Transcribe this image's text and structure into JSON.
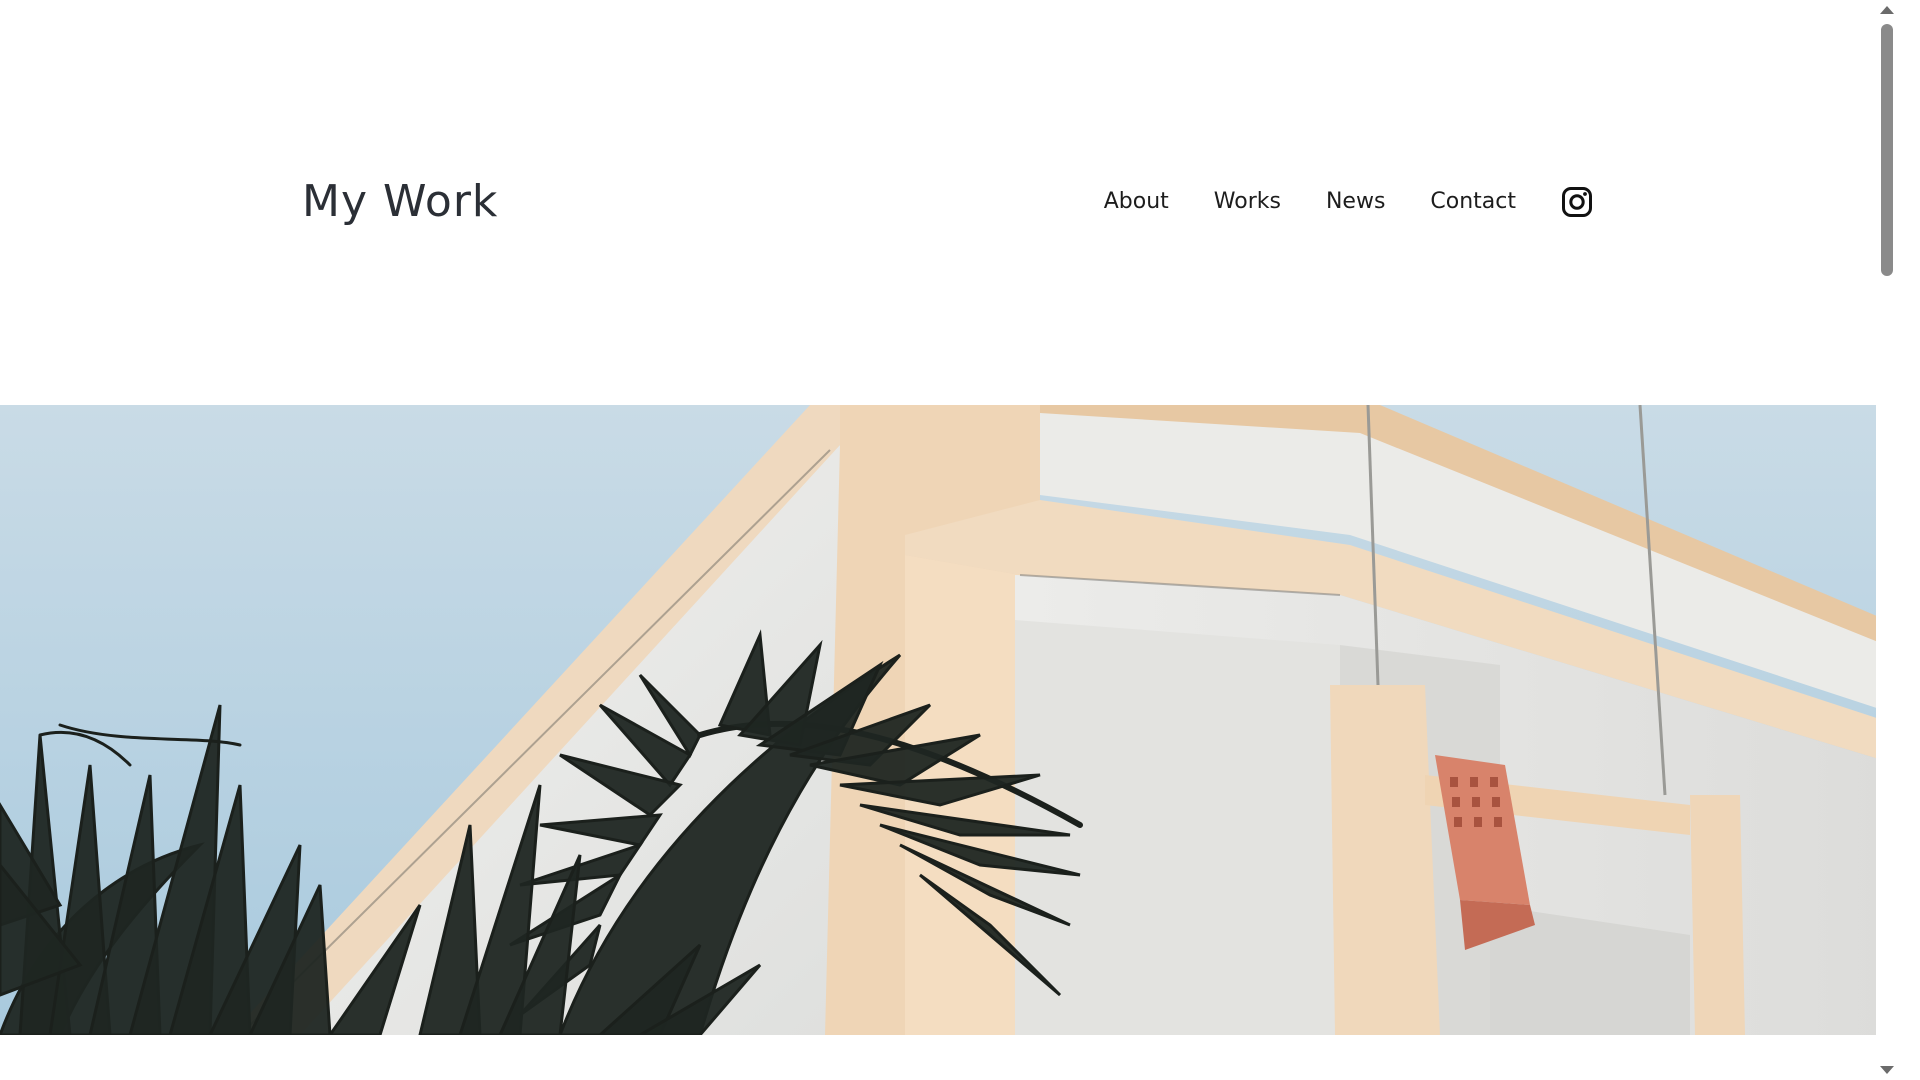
{
  "site": {
    "title": "My Work"
  },
  "nav": {
    "items": [
      {
        "label": "About"
      },
      {
        "label": "Works"
      },
      {
        "label": "News"
      },
      {
        "label": "Contact"
      }
    ],
    "social_icon": "instagram-icon"
  },
  "hero": {
    "image_description_icon": "building-and-palm-photo"
  },
  "colors": {
    "title": "#2b2f36",
    "nav_text": "#1d1d1d",
    "sky": "#b9d3e2",
    "building_beige": "#efd9bf",
    "building_white": "#e9e9e6",
    "palm": "#1e2420",
    "vent": "#d4806b"
  }
}
